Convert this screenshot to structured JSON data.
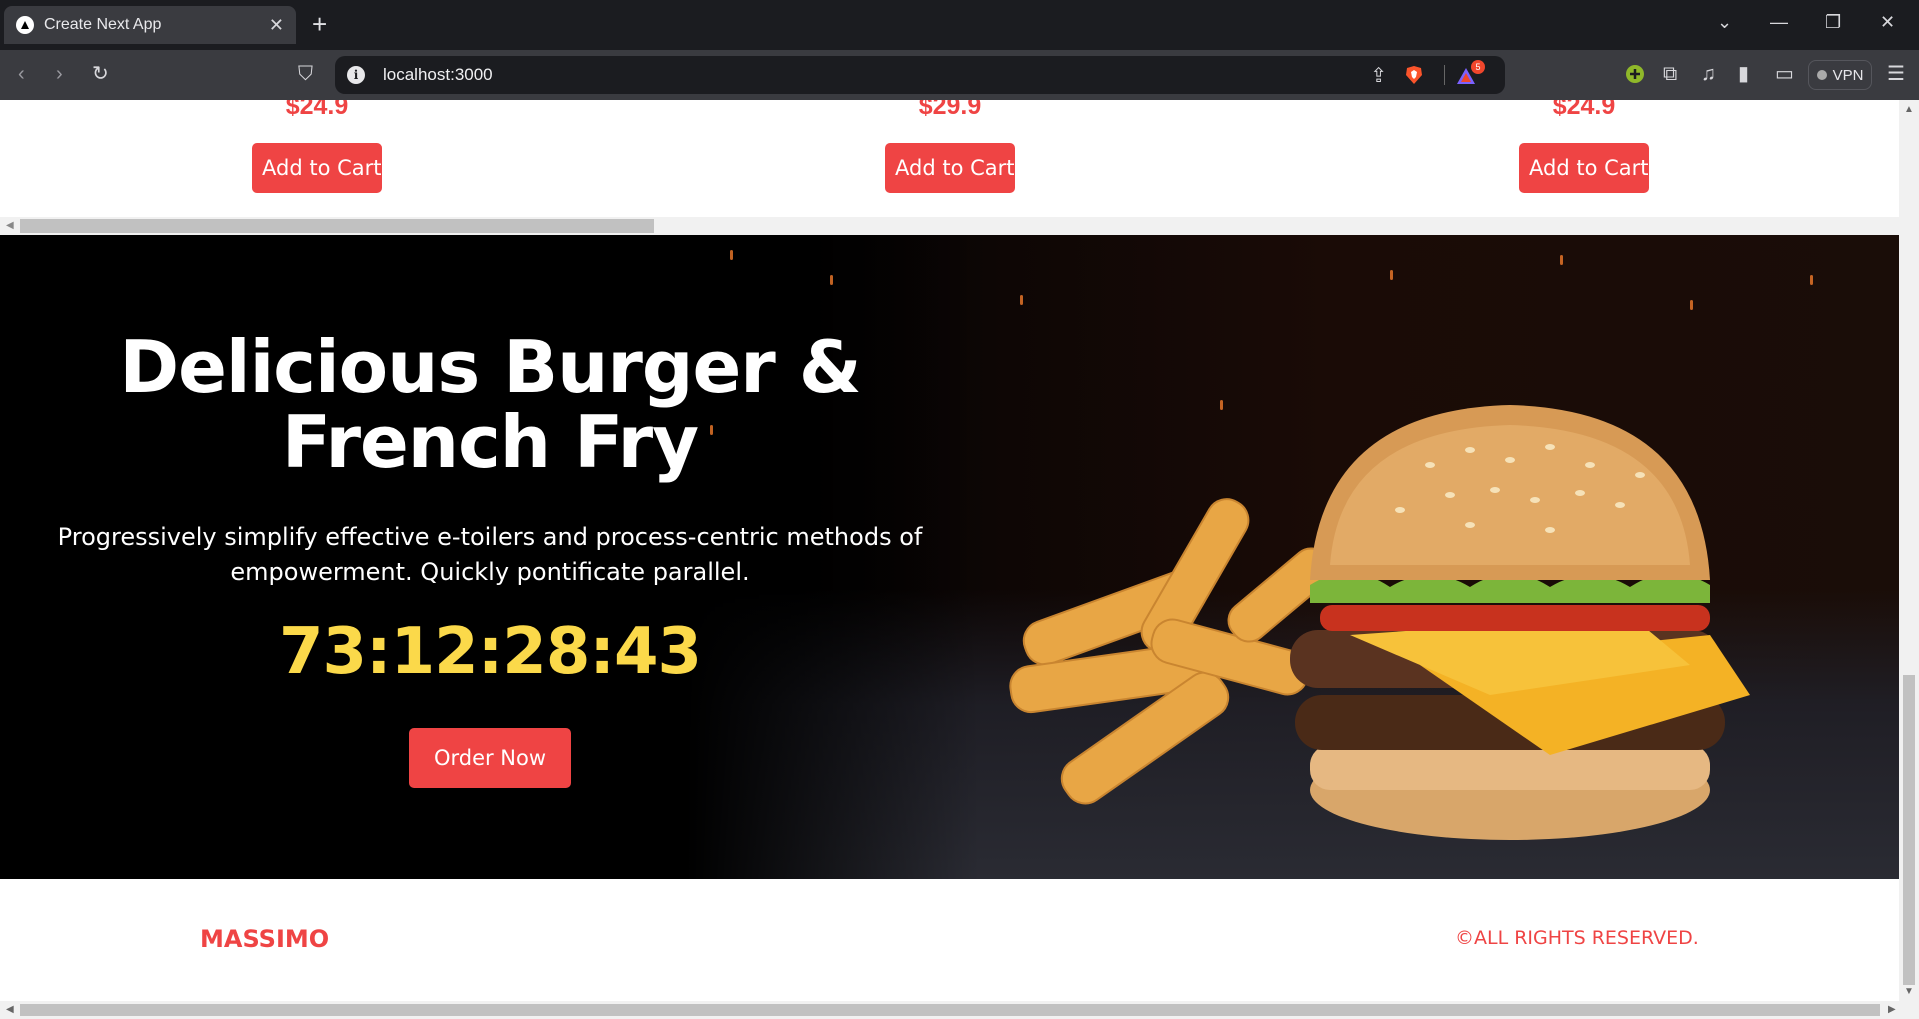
{
  "browser": {
    "tab_title": "Create Next App",
    "tab_close": "✕",
    "new_tab": "+",
    "url": "localhost:3000",
    "vpn_label": "VPN",
    "rewards_badge": "5"
  },
  "products": [
    {
      "price": "$24.9",
      "button": "Add to Cart"
    },
    {
      "price": "$29.9",
      "button": "Add to Cart"
    },
    {
      "price": "$24.9",
      "button": "Add to Cart"
    }
  ],
  "hero": {
    "title": "Delicious Burger & French Fry",
    "description": "Progressively simplify effective e-toilers and process-centric methods of empowerment. Quickly pontificate parallel.",
    "countdown": "73:12:28:43",
    "order_button": "Order Now"
  },
  "footer": {
    "brand": "MASSIMO",
    "copyright": "©ALL RIGHTS RESERVED."
  },
  "colors": {
    "accent": "#ef4444",
    "countdown": "#fbd94a",
    "hero_bg": "#000000"
  }
}
